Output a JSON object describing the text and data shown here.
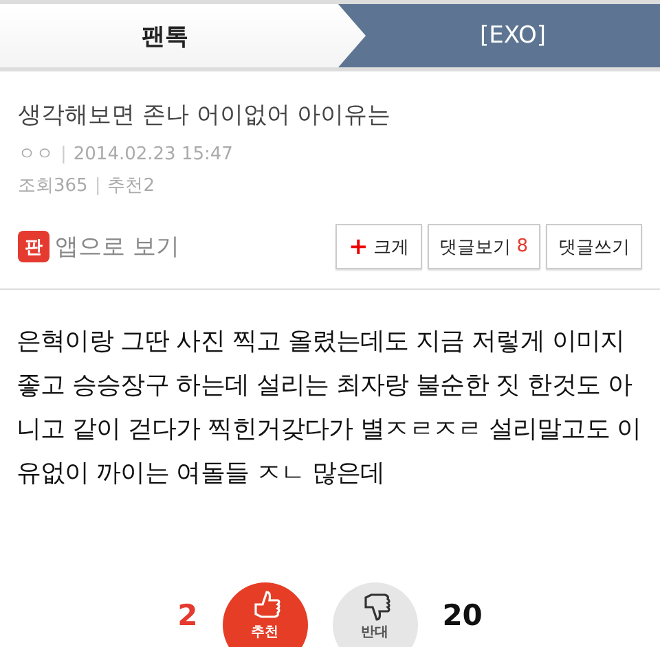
{
  "tabs": [
    {
      "label": "팬톡",
      "selected": false
    },
    {
      "label": "[EXO]",
      "selected": true
    }
  ],
  "post": {
    "title": "생각해보면 존나 어이없어 아이유는",
    "author": "ㅇㅇ",
    "separator": "|",
    "date": "2014.02.23 15:47",
    "views_label": "조회",
    "views": "365",
    "recommend_label": "추천",
    "recommend": "2"
  },
  "app_link": {
    "icon": "판",
    "label": "앱으로 보기"
  },
  "buttons": [
    {
      "kind": "plus",
      "icon": "+",
      "label": "크게"
    },
    {
      "kind": "count",
      "label": "댓글보기",
      "count": "8"
    },
    {
      "kind": "plain",
      "label": "댓글쓰기"
    }
  ],
  "body": "은혁이랑 그딴 사진 찍고 올렸는데도 지금 저렇게 이미지 좋고 승승장구 하는데 설리는 최자랑 불순한 짓 한것도 아니고 같이 걷다가 찍힌거갖다가 별ㅈㄹㅈㄹ 설리말고도 이유없이 까이는 여돌들 ㅈㄴ 많은데",
  "votes": {
    "up_count": "2",
    "up_label": "추천",
    "down_label": "반대",
    "down_count": "20"
  }
}
